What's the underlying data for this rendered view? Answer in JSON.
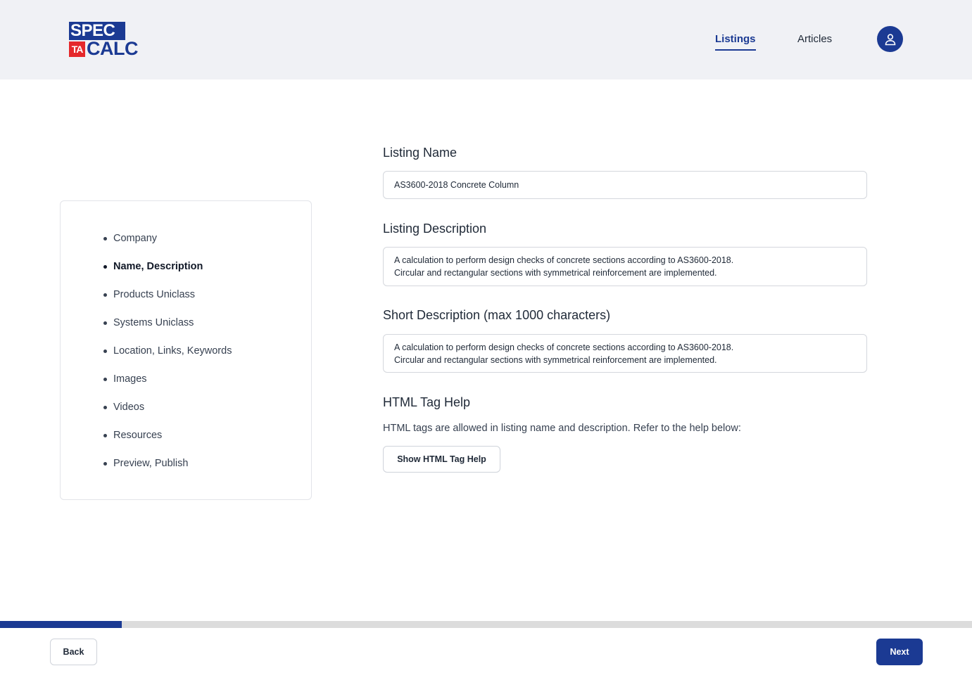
{
  "header": {
    "logo": {
      "line1": "SPEC",
      "badge": "TA",
      "line2": "CALC"
    },
    "nav": [
      {
        "label": "Listings",
        "active": true
      },
      {
        "label": "Articles",
        "active": false
      }
    ],
    "avatar_icon": "user-icon"
  },
  "steps": {
    "items": [
      {
        "label": "Company"
      },
      {
        "label": "Name, Description"
      },
      {
        "label": "Products Uniclass"
      },
      {
        "label": "Systems Uniclass"
      },
      {
        "label": "Location, Links, Keywords"
      },
      {
        "label": "Images"
      },
      {
        "label": "Videos"
      },
      {
        "label": "Resources"
      },
      {
        "label": "Preview, Publish"
      }
    ],
    "active_index": 1
  },
  "form": {
    "listing_name": {
      "title": "Listing Name",
      "value": "AS3600-2018 Concrete Column"
    },
    "listing_description": {
      "title": "Listing Description",
      "line1": "A calculation to perform design checks of concrete sections according to AS3600-2018.",
      "line2": "Circular and rectangular sections with symmetrical reinforcement are implemented."
    },
    "short_description": {
      "title": "Short Description (max 1000 characters)",
      "line1": "A calculation to perform design checks of concrete sections according to AS3600-2018.",
      "line2": "Circular and rectangular sections with symmetrical reinforcement are implemented."
    },
    "html_help": {
      "title": "HTML Tag Help",
      "text": "HTML tags are allowed in listing name and description. Refer to the help below:",
      "button_label": "Show HTML Tag Help"
    }
  },
  "progress": {
    "fraction": 0.125
  },
  "footer": {
    "back_label": "Back",
    "next_label": "Next"
  },
  "colors": {
    "brand": "#1b3a93",
    "accent_red": "#e5282b",
    "header_bg": "#f0f1f5"
  }
}
